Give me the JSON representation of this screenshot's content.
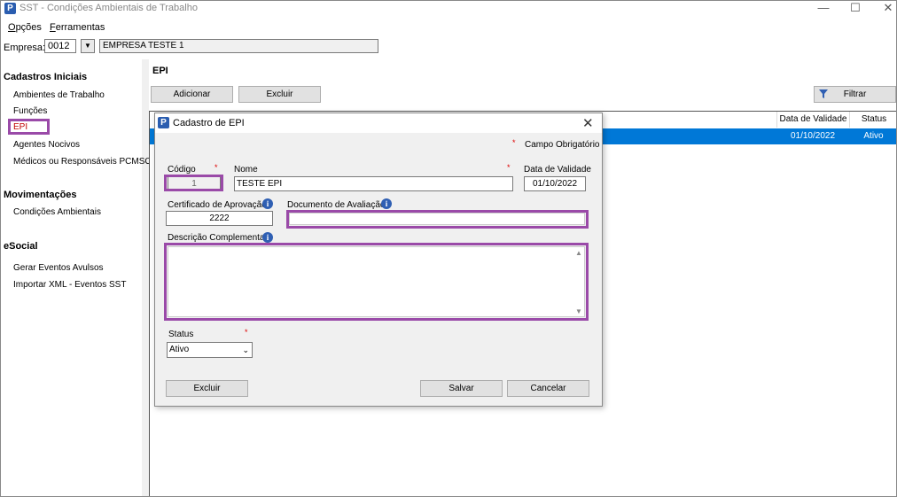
{
  "window": {
    "title": "SST - Condições Ambientais de Trabalho",
    "min": "—",
    "max": "☐",
    "close": "✕"
  },
  "menu": {
    "opcoes_first": "O",
    "opcoes_rest": "pções",
    "ferramentas_first": "F",
    "ferramentas_rest": "erramentas"
  },
  "empresa": {
    "label": "Empresa:",
    "code": "0012",
    "name": "EMPRESA TESTE 1"
  },
  "sidebar": {
    "sections": [
      {
        "title": "Cadastros Iniciais",
        "items": [
          "Ambientes de Trabalho",
          "Funções",
          "EPI",
          "Agentes Nocivos",
          "Médicos ou Responsáveis PCMSO"
        ]
      },
      {
        "title": "Movimentações",
        "items": [
          "Condições Ambientais"
        ]
      },
      {
        "title": "eSocial",
        "items": [
          "Gerar Eventos Avulsos",
          "Importar XML - Eventos SST"
        ]
      }
    ],
    "active_item": "EPI"
  },
  "main": {
    "title": "EPI",
    "buttons": {
      "adicionar": "Adicionar",
      "excluir": "Excluir",
      "filtrar": "Filtrar"
    },
    "grid": {
      "columns": [
        "Data de Validade",
        "Status"
      ],
      "rows": [
        {
          "data_validade": "01/10/2022",
          "status": "Ativo"
        }
      ]
    }
  },
  "dialog": {
    "title": "Cadastro de EPI",
    "required_star": "*",
    "required_legend": "Campo Obrigatório",
    "fields": {
      "codigo": {
        "label": "Código",
        "value": "1"
      },
      "nome": {
        "label": "Nome",
        "value": "TESTE EPI"
      },
      "data_validade": {
        "label": "Data de Validade",
        "value": "01/10/2022"
      },
      "certificado": {
        "label": "Certificado de Aprovação",
        "value": "2222"
      },
      "documento": {
        "label": "Documento de Avaliação",
        "value": ""
      },
      "descricao": {
        "label": "Descrição Complementar",
        "value": ""
      },
      "status": {
        "label": "Status",
        "value": "Ativo"
      }
    },
    "buttons": {
      "excluir": "Excluir",
      "salvar": "Salvar",
      "cancelar": "Cancelar"
    }
  },
  "colors": {
    "selection": "#0078d7",
    "highlight": "#9a4aa8",
    "required": "#dd0000",
    "active_item": "#c00000"
  }
}
